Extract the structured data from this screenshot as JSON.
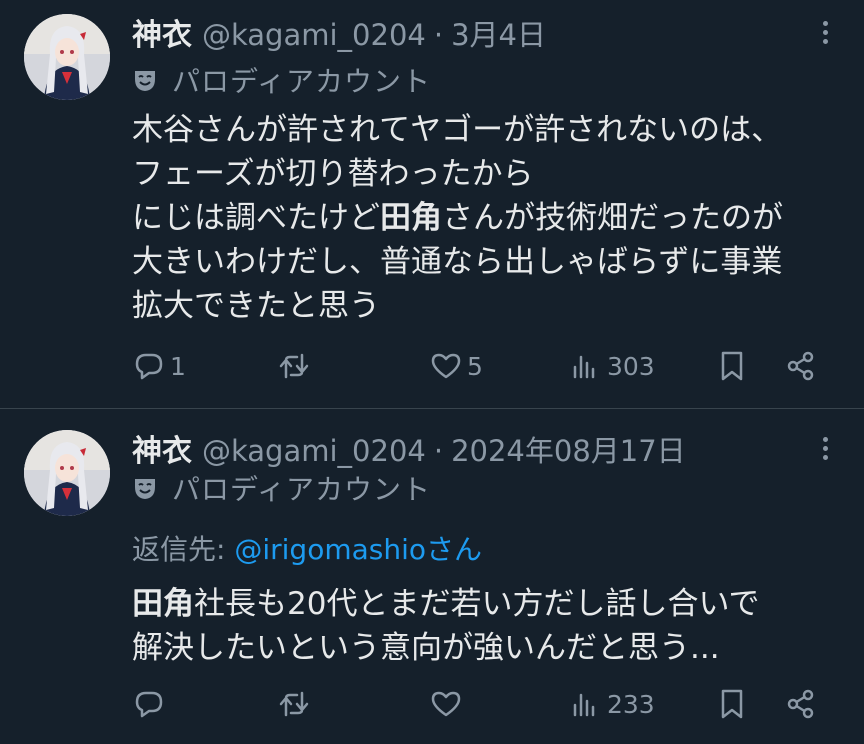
{
  "tweets": [
    {
      "name": "神衣",
      "handle": "@kagami_0204",
      "separator": "·",
      "date": "3月4日",
      "parody_label": "パロディアカウント",
      "body_lines": [
        [
          {
            "t": "木谷さんが許されてヤゴーが許されないのは、",
            "b": false
          }
        ],
        [
          {
            "t": "フェーズが切り替わったから",
            "b": false
          }
        ],
        [
          {
            "t": "にじは調べたけど",
            "b": false
          },
          {
            "t": "田角",
            "b": true
          },
          {
            "t": "さんが技術畑だったのが",
            "b": false
          }
        ],
        [
          {
            "t": "大きいわけだし、普通なら出しゃばらずに事業",
            "b": false
          }
        ],
        [
          {
            "t": "拡大できたと思う",
            "b": false
          }
        ]
      ],
      "stats": {
        "replies": "1",
        "retweets": "",
        "likes": "5",
        "views": "303"
      }
    },
    {
      "name": "神衣",
      "handle": "@kagami_0204",
      "separator": "·",
      "date": "2024年08月17日",
      "parody_label": "パロディアカウント",
      "reply_prefix": "返信先: ",
      "reply_mention": "@irigomashio",
      "reply_suffix": "さん",
      "body_lines": [
        [
          {
            "t": "田角",
            "b": true
          },
          {
            "t": "社長も20代とまだ若い方だし話し合いで",
            "b": false
          }
        ],
        [
          {
            "t": "解決したいという意向が強いんだと思う...",
            "b": false
          }
        ]
      ],
      "stats": {
        "replies": "",
        "retweets": "",
        "likes": "",
        "views": "233"
      }
    }
  ],
  "icons": {
    "reply": "reply-icon",
    "retweet": "retweet-icon",
    "like": "heart-icon",
    "views": "views-icon",
    "bookmark": "bookmark-icon",
    "share": "share-icon",
    "more": "more-icon",
    "parody": "parody-mask-icon"
  },
  "colors": {
    "background": "#15202b",
    "text": "#e7e9ea",
    "muted": "#8b98a5",
    "link": "#1d9bf0",
    "divider": "#38444d"
  }
}
